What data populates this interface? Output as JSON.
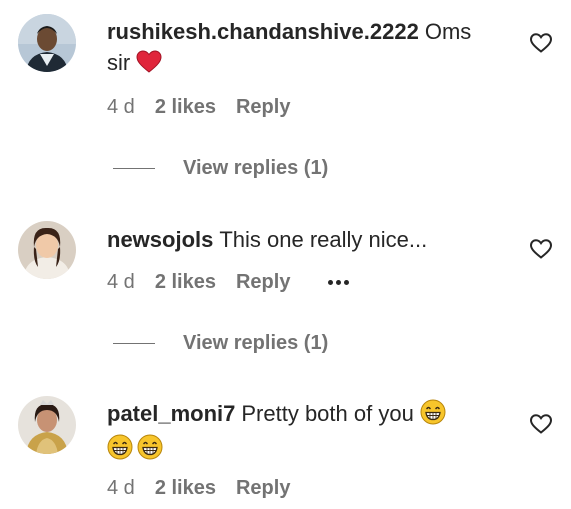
{
  "comments": [
    {
      "username": "rushikesh.chandanshive.2222",
      "text": "Oms sir",
      "emoji": [
        "heart-emoji"
      ],
      "age": "4 d",
      "likes": "2 likes",
      "reply": "Reply",
      "view_replies": "View replies (1)"
    },
    {
      "username": "newsojols",
      "text": "This one really nice...",
      "age": "4 d",
      "likes": "2 likes",
      "reply": "Reply",
      "has_more_menu": true,
      "view_replies": "View replies (1)"
    },
    {
      "username": "patel_moni7",
      "text": "Pretty both of you",
      "emoji": [
        "grinning-face-emoji",
        "grinning-face-emoji",
        "grinning-face-emoji"
      ],
      "age": "4 d",
      "likes": "2 likes",
      "reply": "Reply"
    }
  ],
  "colors": {
    "text": "#262626",
    "secondary": "#737373",
    "heart_emoji": "#e0253b",
    "grin_emoji": "#f7c52b"
  }
}
